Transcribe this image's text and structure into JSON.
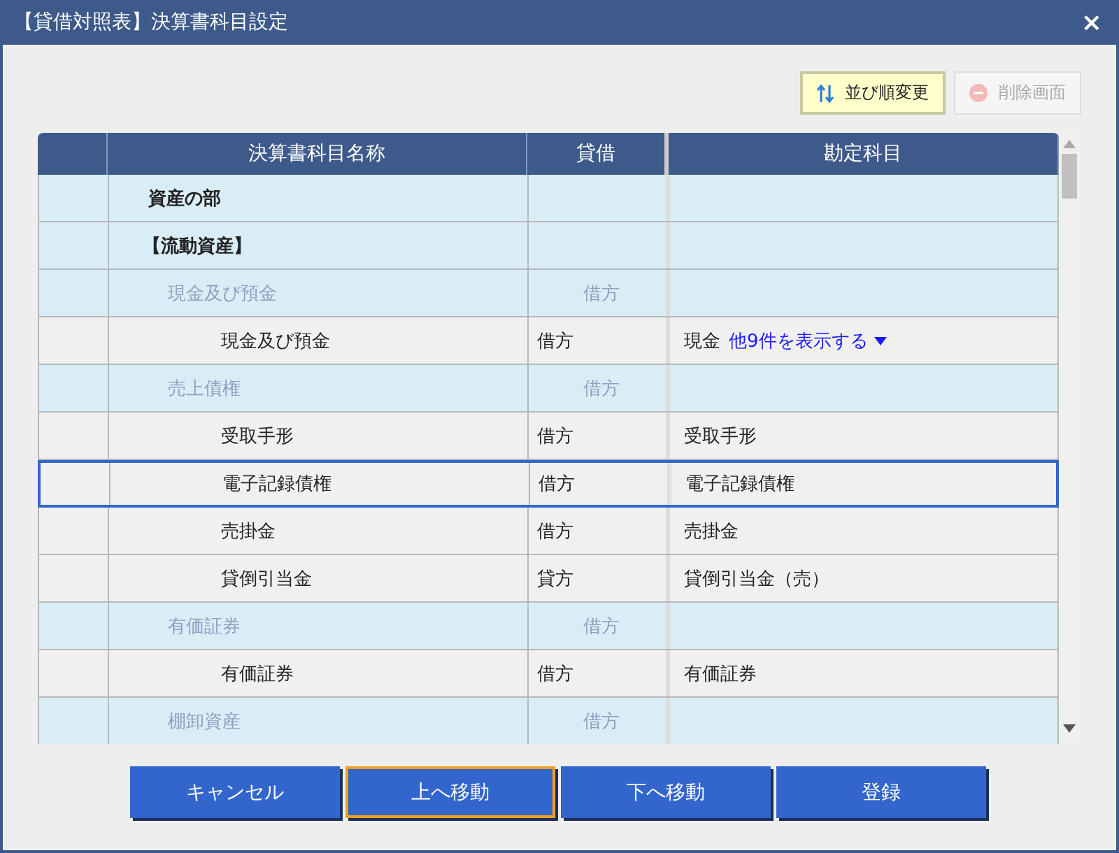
{
  "window": {
    "title": "【貸借対照表】決算書科目設定",
    "close": "×"
  },
  "toolbar": [
    {
      "label": "並び順変更",
      "kind": "sort",
      "disabled": false,
      "highlighted": true
    },
    {
      "label": "削除画面",
      "kind": "delete",
      "disabled": true,
      "highlighted": false
    }
  ],
  "table": {
    "columns": [
      "決算書科目名称",
      "貸借",
      "勘定科目"
    ],
    "rows": [
      {
        "kind": "heading",
        "name": "資産の部",
        "selected": false
      },
      {
        "kind": "subheading",
        "name": "【流動資産】",
        "selected": false
      },
      {
        "kind": "group",
        "name": "現金及び預金",
        "side": "借方",
        "selected": false
      },
      {
        "kind": "item",
        "name": "現金及び預金",
        "side": "借方",
        "account": "現金",
        "more_link": "他9件を表示する",
        "selected": false
      },
      {
        "kind": "group",
        "name": "売上債権",
        "side": "借方",
        "selected": false
      },
      {
        "kind": "item",
        "name": "受取手形",
        "side": "借方",
        "account": "受取手形",
        "selected": false
      },
      {
        "kind": "item",
        "name": "電子記録債権",
        "side": "借方",
        "account": "電子記録債権",
        "selected": true
      },
      {
        "kind": "item",
        "name": "売掛金",
        "side": "借方",
        "account": "売掛金",
        "selected": false
      },
      {
        "kind": "item",
        "name": "貸倒引当金",
        "side": "貸方",
        "account": "貸倒引当金（売）",
        "selected": false
      },
      {
        "kind": "group",
        "name": "有価証券",
        "side": "借方",
        "selected": false
      },
      {
        "kind": "item",
        "name": "有価証券",
        "side": "借方",
        "account": "有価証券",
        "selected": false
      },
      {
        "kind": "group",
        "name": "棚卸資産",
        "side": "借方",
        "selected": false
      }
    ]
  },
  "buttons": [
    {
      "label": "キャンセル",
      "focused": false
    },
    {
      "label": "上へ移動",
      "focused": true
    },
    {
      "label": "下へ移動",
      "focused": false
    },
    {
      "label": "登録",
      "focused": false
    }
  ]
}
